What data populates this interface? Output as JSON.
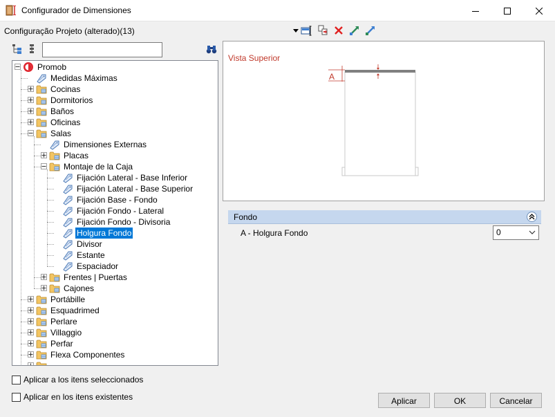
{
  "window": {
    "title": "Configurador de Dimensiones"
  },
  "config": {
    "label": "Configuração Projeto (alterado)(13)"
  },
  "tree": {
    "search_value": "",
    "items": [
      {
        "label": "Promob",
        "level": 0,
        "icon": "promob-logo-icon",
        "expander": "minus"
      },
      {
        "label": "Medidas Máximas",
        "level": 1,
        "icon": "tag-icon",
        "expander": "none"
      },
      {
        "label": "Cocinas",
        "level": 1,
        "icon": "folder-grid-icon",
        "expander": "plus"
      },
      {
        "label": "Dormitorios",
        "level": 1,
        "icon": "folder-grid-icon",
        "expander": "plus"
      },
      {
        "label": "Baños",
        "level": 1,
        "icon": "folder-grid-icon",
        "expander": "plus"
      },
      {
        "label": "Oficinas",
        "level": 1,
        "icon": "folder-grid-icon",
        "expander": "plus"
      },
      {
        "label": "Salas",
        "level": 1,
        "icon": "folder-grid-icon",
        "expander": "minus"
      },
      {
        "label": "Dimensiones Externas",
        "level": 2,
        "icon": "tag-icon",
        "expander": "none"
      },
      {
        "label": "Placas",
        "level": 2,
        "icon": "folder-grid-icon",
        "expander": "plus"
      },
      {
        "label": "Montaje de la Caja",
        "level": 2,
        "icon": "folder-grid-icon",
        "expander": "minus"
      },
      {
        "label": "Fijación Lateral - Base Inferior",
        "level": 3,
        "icon": "tag-icon",
        "expander": "none"
      },
      {
        "label": "Fijación Lateral - Base Superior",
        "level": 3,
        "icon": "tag-icon",
        "expander": "none"
      },
      {
        "label": " Fijación Base - Fondo",
        "level": 3,
        "icon": "tag-icon",
        "expander": "none"
      },
      {
        "label": "Fijación Fondo - Lateral",
        "level": 3,
        "icon": "tag-icon",
        "expander": "none"
      },
      {
        "label": "Fijación Fondo - Divisoria",
        "level": 3,
        "icon": "tag-icon",
        "expander": "none"
      },
      {
        "label": "Holgura Fondo",
        "level": 3,
        "icon": "tag-icon",
        "expander": "none",
        "selected": true
      },
      {
        "label": "Divisor",
        "level": 3,
        "icon": "tag-icon",
        "expander": "none"
      },
      {
        "label": "Estante",
        "level": 3,
        "icon": "tag-icon",
        "expander": "none"
      },
      {
        "label": "Espaciador",
        "level": 3,
        "icon": "tag-icon",
        "expander": "none"
      },
      {
        "label": "Frentes | Puertas",
        "level": 2,
        "icon": "folder-grid-icon",
        "expander": "plus"
      },
      {
        "label": "Cajones",
        "level": 2,
        "icon": "folder-grid-icon",
        "expander": "plus"
      },
      {
        "label": "Portábille",
        "level": 1,
        "icon": "folder-grid-icon",
        "expander": "plus"
      },
      {
        "label": "Esquadrimed",
        "level": 1,
        "icon": "folder-grid-icon",
        "expander": "plus"
      },
      {
        "label": "Perlare",
        "level": 1,
        "icon": "folder-grid-icon",
        "expander": "plus"
      },
      {
        "label": "Villaggio",
        "level": 1,
        "icon": "folder-grid-icon",
        "expander": "plus"
      },
      {
        "label": "Perfar",
        "level": 1,
        "icon": "folder-grid-icon",
        "expander": "plus"
      },
      {
        "label": "Flexa Componentes",
        "level": 1,
        "icon": "folder-grid-icon",
        "expander": "plus"
      },
      {
        "label": "",
        "level": 1,
        "icon": "folder-grid-icon",
        "expander": "plus"
      }
    ]
  },
  "preview": {
    "view_title": "Vista Superior",
    "dimension_letter": "A"
  },
  "properties": {
    "group_label": "Fondo",
    "row_label": "A - Holgura Fondo",
    "row_value": "0"
  },
  "options": {
    "apply_selected": "Aplicar a los itens seleccionados",
    "apply_existing": "Aplicar en los itens existentes"
  },
  "buttons": {
    "apply": "Aplicar",
    "ok": "OK",
    "cancel": "Cancelar"
  },
  "colors": {
    "selection": "#0078d7",
    "group_header": "#c5d7ee",
    "view_title": "#c0392b",
    "folder": "#f3c562"
  }
}
